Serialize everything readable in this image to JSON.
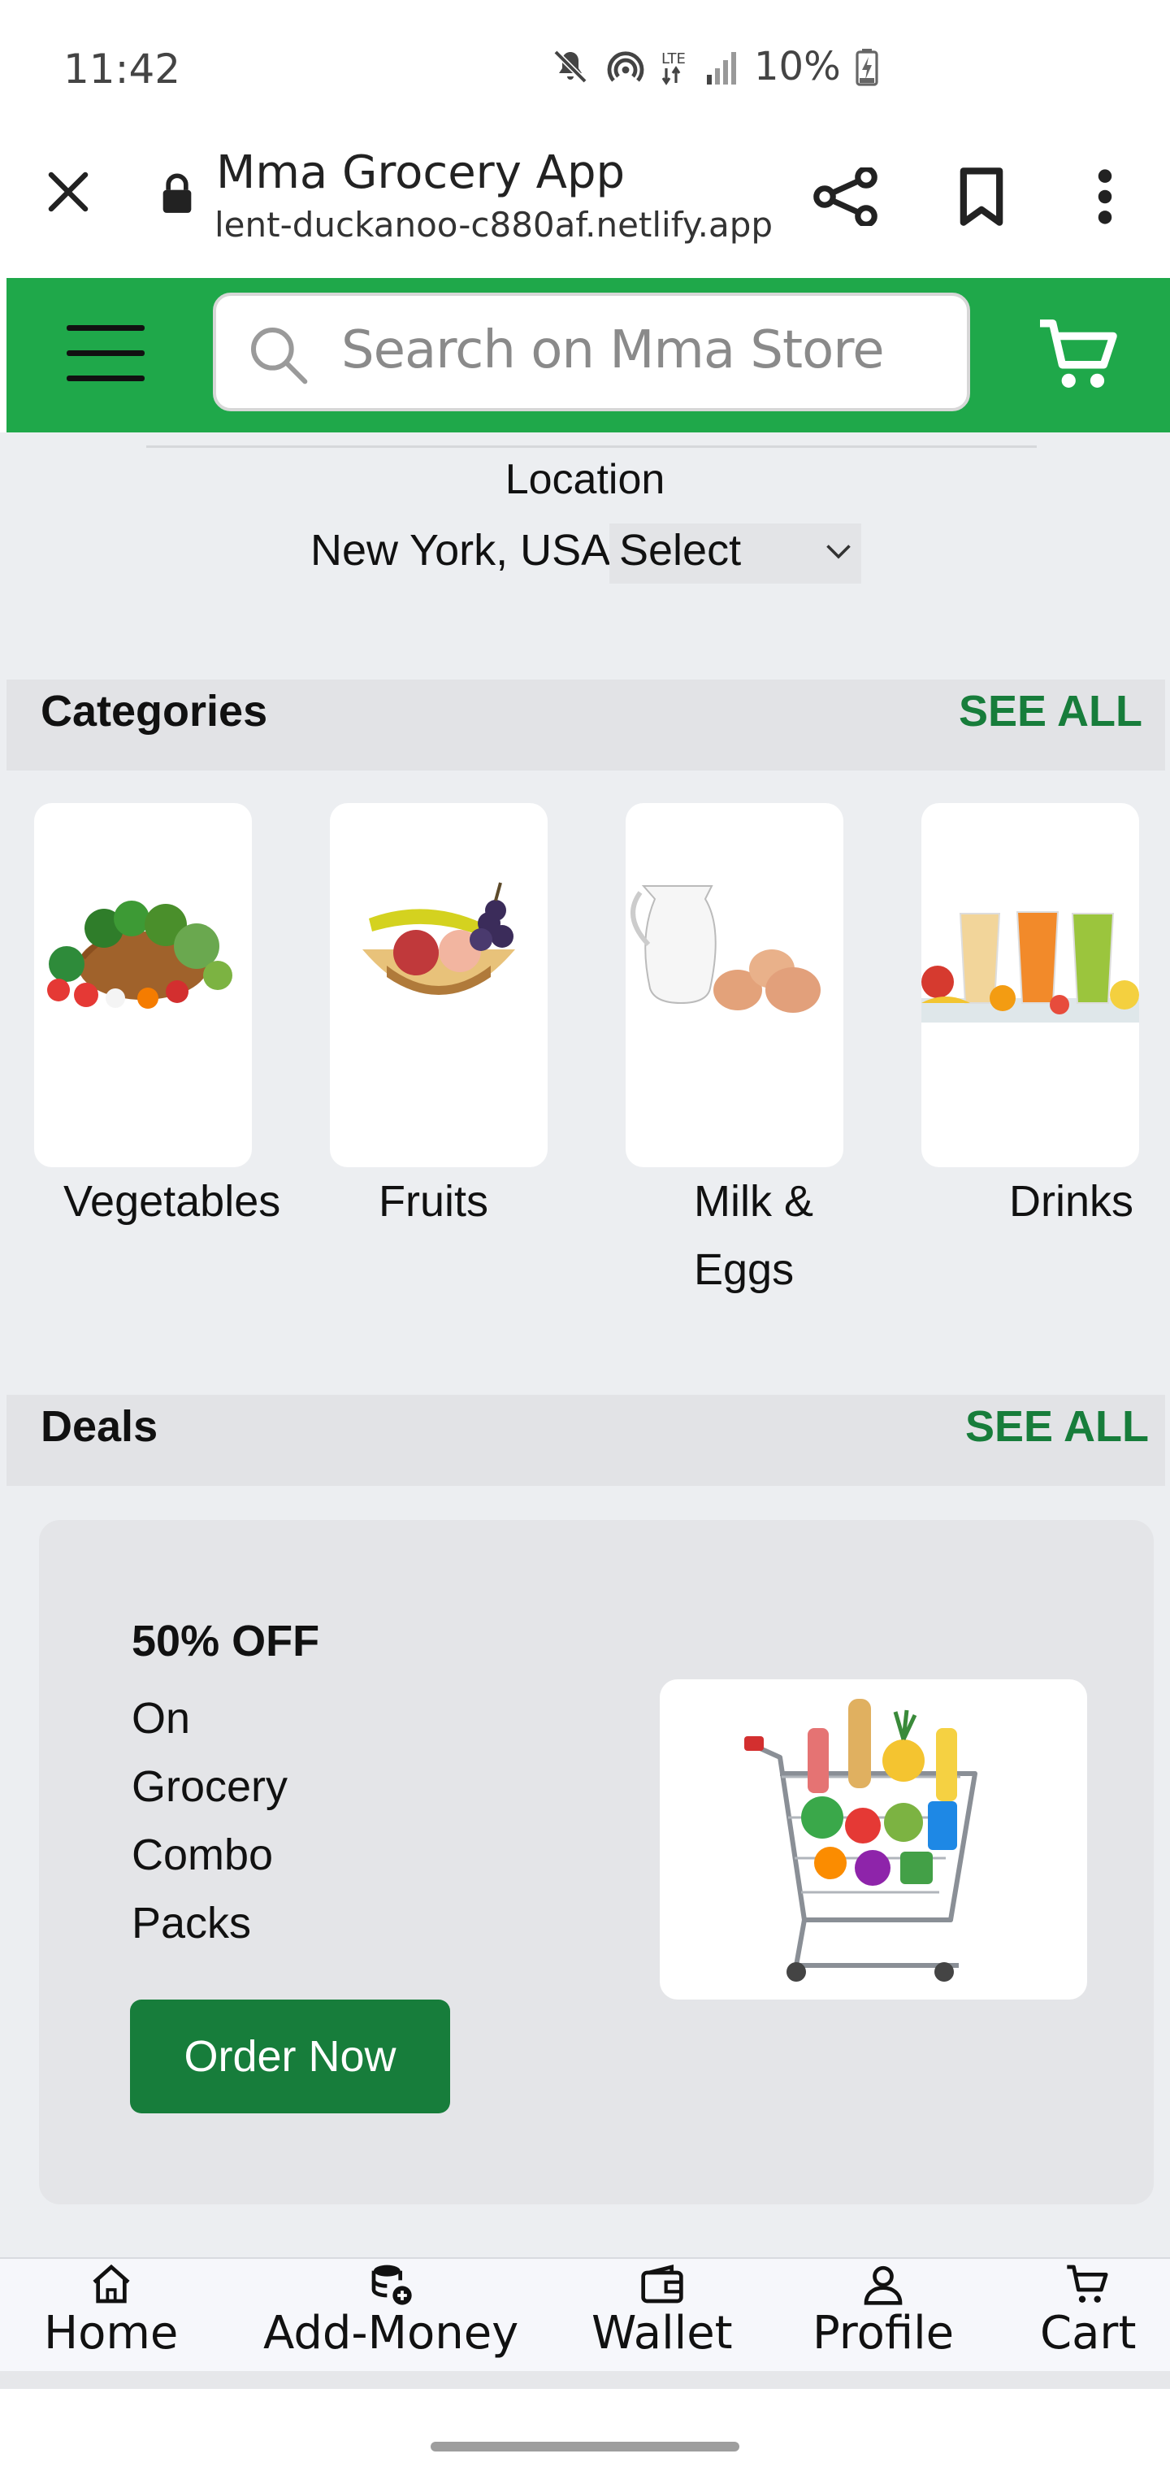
{
  "status_bar": {
    "time": "11:42",
    "network": "LTE",
    "battery": "10%"
  },
  "browser": {
    "page_title": "Mma Grocery App",
    "url": "lent-duckanoo-c880af.netlify.app"
  },
  "header": {
    "search_placeholder": "Search on Mma Store",
    "accent_color": "#1fa84a"
  },
  "location": {
    "label": "Location",
    "value": "New York, USA",
    "select_label": "Select"
  },
  "categories": {
    "title": "Categories",
    "see_all": "SEE ALL",
    "items": [
      {
        "label": "Vegetables",
        "icon": "vegetable-basket-image"
      },
      {
        "label": "Fruits",
        "icon": "fruit-basket-image"
      },
      {
        "label": "Milk & Eggs",
        "icon": "milk-eggs-image"
      },
      {
        "label": "Drinks",
        "icon": "drinks-image"
      }
    ]
  },
  "deals": {
    "title": "Deals",
    "see_all": "SEE ALL",
    "card": {
      "headline": "50% OFF",
      "line1": "On",
      "line2": "Grocery",
      "line3": "Combo",
      "line4": "Packs",
      "button": "Order Now",
      "button_color": "#177d3b"
    }
  },
  "bottom_nav": {
    "items": [
      {
        "label": "Home",
        "icon": "home-icon"
      },
      {
        "label": "Add-Money",
        "icon": "add-money-icon"
      },
      {
        "label": "Wallet",
        "icon": "wallet-icon"
      },
      {
        "label": "Profile",
        "icon": "profile-icon"
      },
      {
        "label": "Cart",
        "icon": "cart-icon"
      }
    ]
  }
}
